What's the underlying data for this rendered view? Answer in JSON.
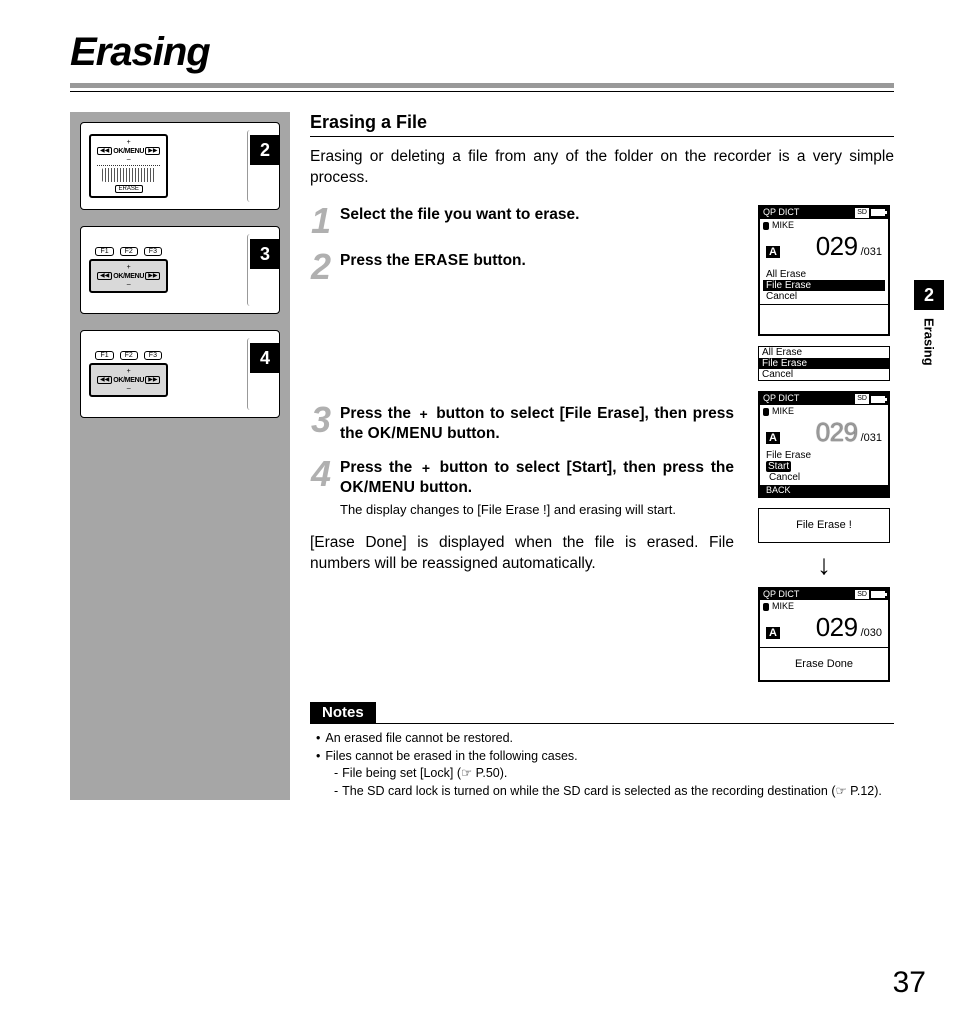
{
  "title": "Erasing",
  "thumb_badges": [
    "2",
    "3",
    "4"
  ],
  "thumb_labels": {
    "okmenu": "OK/MENU",
    "plus": "+",
    "minus": "–",
    "erase": "ERASE",
    "f1": "F1",
    "f2": "F2",
    "f3": "F3"
  },
  "section_head": "Erasing a File",
  "lead": "Erasing or deleting a file from any of the folder on the recorder is a very simple process.",
  "steps": [
    {
      "num": "1",
      "title": "Select the file you want to erase."
    },
    {
      "num": "2",
      "title_pre": "Press the ",
      "btn": "ERASE",
      "title_post": " button."
    },
    {
      "num": "3",
      "title_pre": "Press the ",
      "icon": "+",
      "title_mid": " button to select [File Erase], then press the ",
      "btn": "OK/MENU",
      "title_post": " button."
    },
    {
      "num": "4",
      "title_pre": "Press the ",
      "icon": "+",
      "title_mid": " button to select [Start], then press the ",
      "btn": "OK/MENU",
      "title_post": " button.",
      "sub": "The display changes to [File Erase !] and erasing will start."
    }
  ],
  "para": "[Erase Done] is displayed when the file is erased. File numbers will be reassigned automatically.",
  "lcd": {
    "qp": "QP DICT",
    "sd": "SD",
    "mike": "MIKE",
    "a": "A",
    "c1_big": "029",
    "c1_small": "/031",
    "menu_all": "All Erase",
    "menu_file": "File Erase",
    "menu_cancel": "Cancel",
    "menu_start": "Start",
    "menu_back": "BACK",
    "msg_erase": "File Erase !",
    "msg_done": "Erase Done",
    "c3_big": "029",
    "c3_small": "/030"
  },
  "notes_label": "Notes",
  "notes": {
    "b1": "An erased file cannot be restored.",
    "b2": "Files cannot be erased in the following cases.",
    "d1": "File being set [Lock] (☞ P.50).",
    "d2": "The SD card lock is turned on while the SD card is selected as the recording destination (☞ P.12)."
  },
  "side": {
    "num": "2",
    "label": "Erasing"
  },
  "page_num": "37"
}
